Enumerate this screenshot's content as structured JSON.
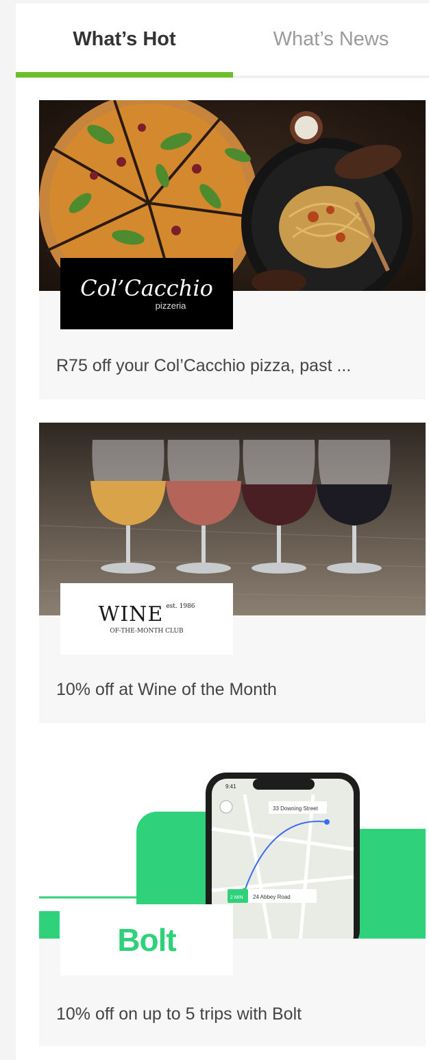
{
  "tabs": [
    {
      "label": "What’s Hot",
      "active": true
    },
    {
      "label": "What’s News",
      "active": false
    }
  ],
  "colors": {
    "accent": "#6cbf2b",
    "bolt_green": "#2fd27b",
    "text": "#444444",
    "muted_tab": "#9b9b9b"
  },
  "cards": [
    {
      "logo_text": "Col’Cacchio",
      "logo_subtext": "pizzeria",
      "caption": "R75 off your Col’Cacchio pizza, past ..."
    },
    {
      "logo_text": "WINE",
      "logo_est": "est. 1986",
      "logo_subtext": "OF-THE-MONTH CLUB",
      "caption": "10% off at Wine of the Month"
    },
    {
      "logo_text": "Bolt",
      "phone_time": "9:41",
      "phone_destination": "33 Downing Street",
      "phone_eta": "2 MIN",
      "phone_pickup": "24 Abbey Road",
      "caption": "10% off on up to 5 trips with Bolt"
    }
  ]
}
